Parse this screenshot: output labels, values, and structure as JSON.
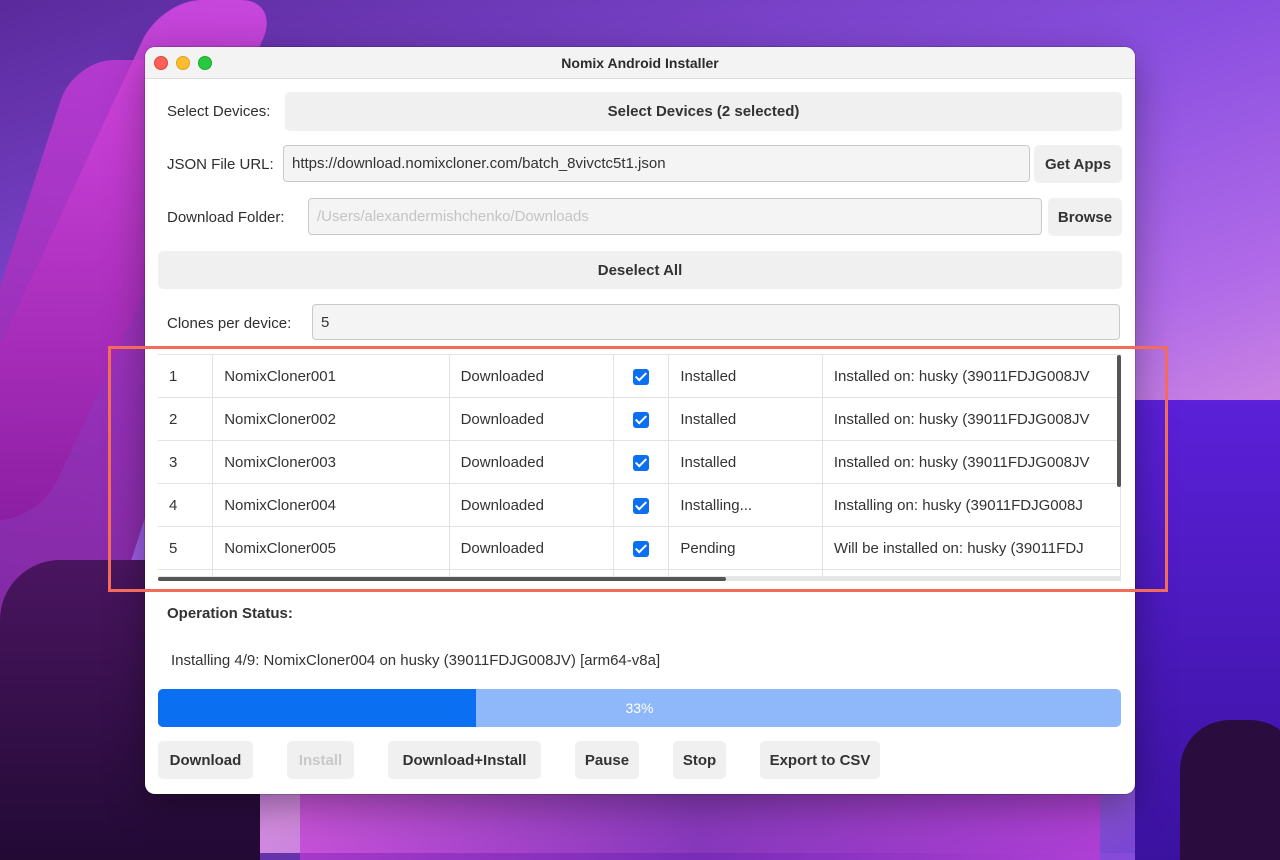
{
  "window": {
    "title": "Nomix Android Installer"
  },
  "devices": {
    "label": "Select Devices:",
    "button": "Select Devices (2 selected)"
  },
  "json_url": {
    "label": "JSON File URL:",
    "value": "https://download.nomixcloner.com/batch_8vivctc5t1.json",
    "button": "Get Apps"
  },
  "download_folder": {
    "label": "Download Folder:",
    "placeholder": "/Users/alexandermishchenko/Downloads",
    "button": "Browse"
  },
  "deselect_all": "Deselect All",
  "clones": {
    "label": "Clones per device:",
    "value": "5"
  },
  "table": {
    "rows": [
      {
        "num": "1",
        "name": "NomixCloner001",
        "download": "Downloaded",
        "checked": true,
        "status": "Installed",
        "detail": "Installed on: husky (39011FDJG008JV"
      },
      {
        "num": "2",
        "name": "NomixCloner002",
        "download": "Downloaded",
        "checked": true,
        "status": "Installed",
        "detail": "Installed on: husky (39011FDJG008JV"
      },
      {
        "num": "3",
        "name": "NomixCloner003",
        "download": "Downloaded",
        "checked": true,
        "status": "Installed",
        "detail": "Installed on: husky (39011FDJG008JV"
      },
      {
        "num": "4",
        "name": "NomixCloner004",
        "download": "Downloaded",
        "checked": true,
        "status": "Installing...",
        "detail": "Installing on: husky (39011FDJG008J"
      },
      {
        "num": "5",
        "name": "NomixCloner005",
        "download": "Downloaded",
        "checked": true,
        "status": "Pending",
        "detail": "Will be installed on: husky (39011FDJ"
      }
    ]
  },
  "operation": {
    "title": "Operation Status:",
    "message": "Installing 4/9: NomixCloner004 on husky (39011FDJG008JV) [arm64-v8a]",
    "progress_percent": 33,
    "progress_label": "33%"
  },
  "actions": {
    "download": "Download",
    "install": "Install",
    "download_install": "Download+Install",
    "pause": "Pause",
    "stop": "Stop",
    "export": "Export to CSV"
  },
  "colors": {
    "accent": "#0a6ff0",
    "progress_track": "#8fb8fb",
    "highlight": "#f26b5b"
  }
}
